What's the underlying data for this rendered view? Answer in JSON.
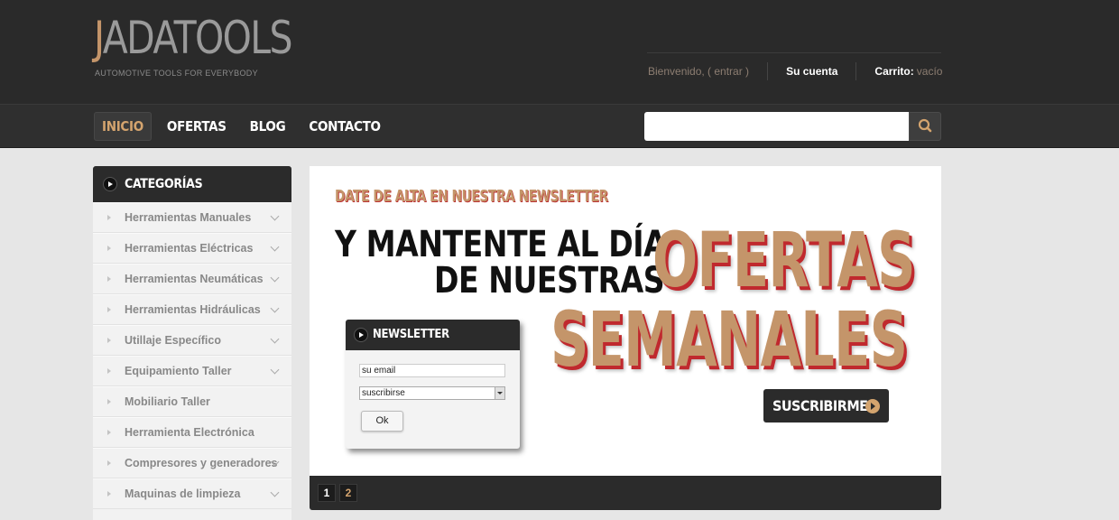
{
  "header": {
    "logo_j": "J",
    "logo_rest": "ADATOOLS",
    "tagline": "AUTOMOTIVE TOOLS FOR EVERYBODY",
    "welcome": "Bienvenido, ( entrar )",
    "account": "Su cuenta",
    "cart_label": "Carrito:",
    "cart_value": "vacío"
  },
  "nav": {
    "items": [
      "INICIO",
      "OFERTAS",
      "BLOG",
      "CONTACTO"
    ],
    "active_index": 0
  },
  "search": {
    "value": "",
    "icon": "search-icon"
  },
  "sidebar": {
    "title": "CATEGORÍAS",
    "items": [
      {
        "label": "Herramientas Manuales",
        "expandable": true
      },
      {
        "label": "Herramientas Eléctricas",
        "expandable": true
      },
      {
        "label": "Herramientas Neumáticas",
        "expandable": true
      },
      {
        "label": "Herramientas Hidráulicas",
        "expandable": true
      },
      {
        "label": "Utillaje Específico",
        "expandable": true
      },
      {
        "label": "Equipamiento Taller",
        "expandable": true
      },
      {
        "label": "Mobiliario Taller",
        "expandable": false
      },
      {
        "label": "Herramienta Electrónica",
        "expandable": false
      },
      {
        "label": "Compresores y generadores",
        "expandable": true
      },
      {
        "label": "Maquinas de limpieza",
        "expandable": true
      }
    ]
  },
  "banner": {
    "small": "DATE DE ALTA EN NUESTRA NEWSLETTER",
    "line1": "Y MANTENTE AL DÍA",
    "line2": "DE NUESTRAS",
    "big1": "OFERTAS",
    "big2": "SEMANALES",
    "cta": "SUSCRIBIRME"
  },
  "newsletter": {
    "title": "NEWSLETTER",
    "email_value": "su email",
    "select_value": "suscribirse",
    "ok": "Ok"
  },
  "pager": {
    "pages": [
      "1",
      "2"
    ],
    "current": "1"
  },
  "colors": {
    "accent": "#c4956a",
    "shadow_red": "#c0292e",
    "dark": "#2b2b2b"
  }
}
